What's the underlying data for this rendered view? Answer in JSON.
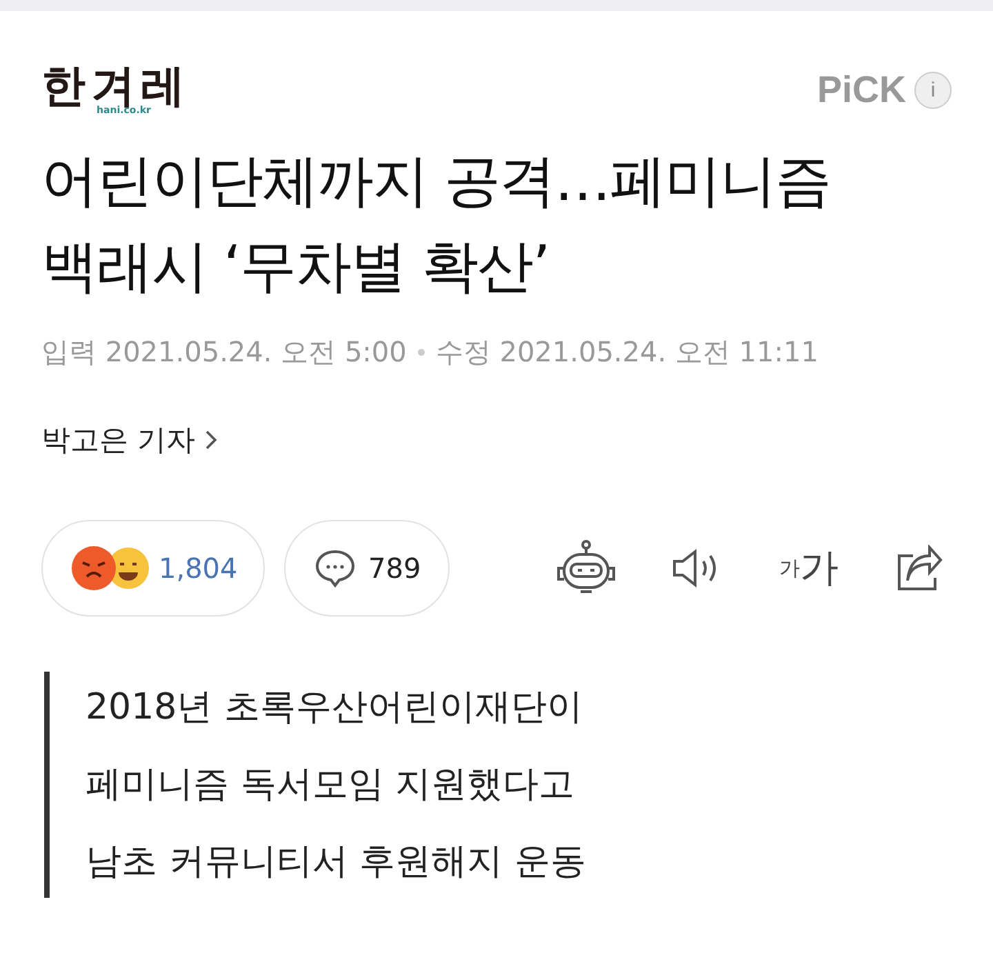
{
  "header": {
    "logo": "한겨레",
    "logo_domain": "hani.co.kr",
    "badge": "PiCK",
    "info": "i"
  },
  "headline": "어린이단체까지 공격…페미니즘 백래시 ‘무차별 확산’",
  "dates": {
    "input_label": "입력",
    "input_time": "2021.05.24. 오전 5:00",
    "edit_label": "수정",
    "edit_time": "2021.05.24. 오전 11:11"
  },
  "reporter": "박고은 기자",
  "reactions": {
    "count": "1,804"
  },
  "comments": {
    "count": "789"
  },
  "font_size": {
    "small": "가",
    "large": "가"
  },
  "summary": [
    "2018년 초록우산어린이재단이",
    "페미니즘 독서모임 지원했다고",
    "남초 커뮤니티서 후원해지 운동"
  ]
}
